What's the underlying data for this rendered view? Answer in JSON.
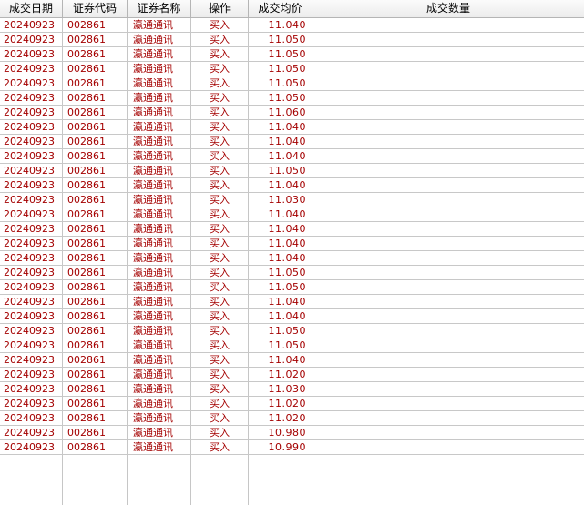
{
  "table": {
    "columns": [
      "成交日期",
      "证券代码",
      "证券名称",
      "操作",
      "成交均价",
      "成交数量"
    ],
    "rows": [
      {
        "date": "20240923",
        "code": "002861",
        "name": "瀛通通讯",
        "action": "买入",
        "price": "11.040",
        "qty": ""
      },
      {
        "date": "20240923",
        "code": "002861",
        "name": "瀛通通讯",
        "action": "买入",
        "price": "11.050",
        "qty": ""
      },
      {
        "date": "20240923",
        "code": "002861",
        "name": "瀛通通讯",
        "action": "买入",
        "price": "11.050",
        "qty": ""
      },
      {
        "date": "20240923",
        "code": "002861",
        "name": "瀛通通讯",
        "action": "买入",
        "price": "11.050",
        "qty": ""
      },
      {
        "date": "20240923",
        "code": "002861",
        "name": "瀛通通讯",
        "action": "买入",
        "price": "11.050",
        "qty": ""
      },
      {
        "date": "20240923",
        "code": "002861",
        "name": "瀛通通讯",
        "action": "买入",
        "price": "11.050",
        "qty": ""
      },
      {
        "date": "20240923",
        "code": "002861",
        "name": "瀛通通讯",
        "action": "买入",
        "price": "11.060",
        "qty": ""
      },
      {
        "date": "20240923",
        "code": "002861",
        "name": "瀛通通讯",
        "action": "买入",
        "price": "11.040",
        "qty": ""
      },
      {
        "date": "20240923",
        "code": "002861",
        "name": "瀛通通讯",
        "action": "买入",
        "price": "11.040",
        "qty": ""
      },
      {
        "date": "20240923",
        "code": "002861",
        "name": "瀛通通讯",
        "action": "买入",
        "price": "11.040",
        "qty": ""
      },
      {
        "date": "20240923",
        "code": "002861",
        "name": "瀛通通讯",
        "action": "买入",
        "price": "11.050",
        "qty": ""
      },
      {
        "date": "20240923",
        "code": "002861",
        "name": "瀛通通讯",
        "action": "买入",
        "price": "11.040",
        "qty": ""
      },
      {
        "date": "20240923",
        "code": "002861",
        "name": "瀛通通讯",
        "action": "买入",
        "price": "11.030",
        "qty": ""
      },
      {
        "date": "20240923",
        "code": "002861",
        "name": "瀛通通讯",
        "action": "买入",
        "price": "11.040",
        "qty": ""
      },
      {
        "date": "20240923",
        "code": "002861",
        "name": "瀛通通讯",
        "action": "买入",
        "price": "11.040",
        "qty": ""
      },
      {
        "date": "20240923",
        "code": "002861",
        "name": "瀛通通讯",
        "action": "买入",
        "price": "11.040",
        "qty": ""
      },
      {
        "date": "20240923",
        "code": "002861",
        "name": "瀛通通讯",
        "action": "买入",
        "price": "11.040",
        "qty": ""
      },
      {
        "date": "20240923",
        "code": "002861",
        "name": "瀛通通讯",
        "action": "买入",
        "price": "11.050",
        "qty": ""
      },
      {
        "date": "20240923",
        "code": "002861",
        "name": "瀛通通讯",
        "action": "买入",
        "price": "11.050",
        "qty": ""
      },
      {
        "date": "20240923",
        "code": "002861",
        "name": "瀛通通讯",
        "action": "买入",
        "price": "11.040",
        "qty": ""
      },
      {
        "date": "20240923",
        "code": "002861",
        "name": "瀛通通讯",
        "action": "买入",
        "price": "11.040",
        "qty": ""
      },
      {
        "date": "20240923",
        "code": "002861",
        "name": "瀛通通讯",
        "action": "买入",
        "price": "11.050",
        "qty": ""
      },
      {
        "date": "20240923",
        "code": "002861",
        "name": "瀛通通讯",
        "action": "买入",
        "price": "11.050",
        "qty": ""
      },
      {
        "date": "20240923",
        "code": "002861",
        "name": "瀛通通讯",
        "action": "买入",
        "price": "11.040",
        "qty": ""
      },
      {
        "date": "20240923",
        "code": "002861",
        "name": "瀛通通讯",
        "action": "买入",
        "price": "11.020",
        "qty": ""
      },
      {
        "date": "20240923",
        "code": "002861",
        "name": "瀛通通讯",
        "action": "买入",
        "price": "11.030",
        "qty": ""
      },
      {
        "date": "20240923",
        "code": "002861",
        "name": "瀛通通讯",
        "action": "买入",
        "price": "11.020",
        "qty": ""
      },
      {
        "date": "20240923",
        "code": "002861",
        "name": "瀛通通讯",
        "action": "买入",
        "price": "11.020",
        "qty": ""
      },
      {
        "date": "20240923",
        "code": "002861",
        "name": "瀛通通讯",
        "action": "买入",
        "price": "10.980",
        "qty": ""
      },
      {
        "date": "20240923",
        "code": "002861",
        "name": "瀛通通讯",
        "action": "买入",
        "price": "10.990",
        "qty": ""
      }
    ]
  },
  "colors": {
    "cell_text": "#a40000",
    "grid_line": "#c8c8c8",
    "header_bg": "#f4f4f4"
  }
}
